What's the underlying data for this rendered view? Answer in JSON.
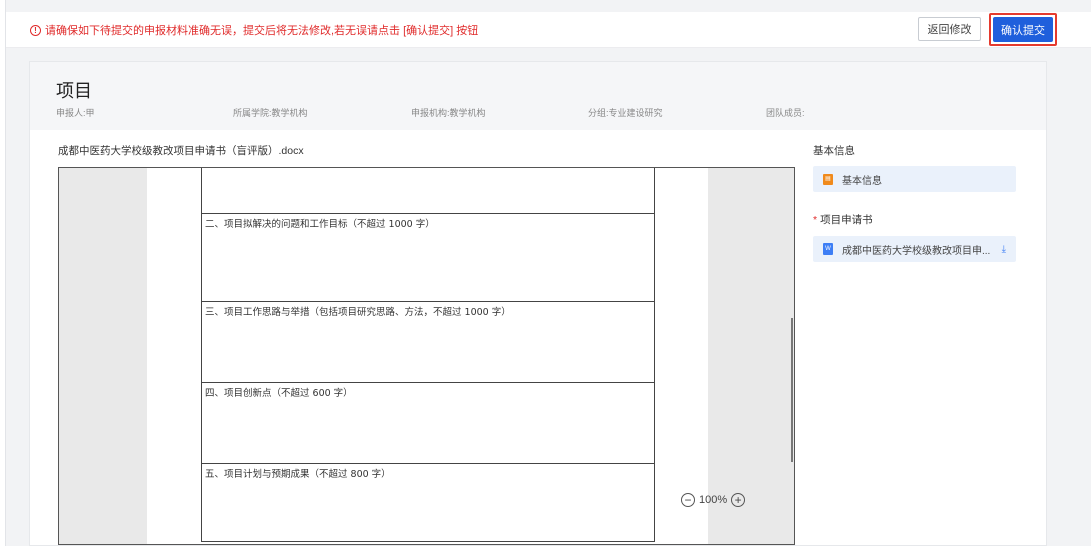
{
  "topbar": {
    "warning_icon": "info-circle-icon",
    "warning": "请确保如下待提交的申报材料准确无误，提交后将无法修改,若无误请点击 [确认提交] 按钮",
    "back_label": "返回修改",
    "confirm_label": "确认提交"
  },
  "project": {
    "title": "项目",
    "applicant": "申报人:甲",
    "college": "所属学院:教学机构",
    "institution": "申报机构:教学机构",
    "group": "分组:专业建设研究",
    "team": "团队成员:"
  },
  "document": {
    "name": "成都中医药大学校级教改项目申请书（盲评版）.docx",
    "sections": [
      "二、项目拟解决的问题和工作目标（不超过 1000 字）",
      "三、项目工作思路与举措（包括项目研究思路、方法，不超过 1000 字）",
      "四、项目创新点（不超过 600 字）",
      "五、项目计划与预期成果（不超过 800 字）"
    ],
    "zoom": "100%"
  },
  "sidebar": {
    "basic_heading": "基本信息",
    "basic_item": "基本信息",
    "required_mark": "*",
    "app_heading": "项目申请书",
    "file_item": "成都中医药大学校级教改项目申...",
    "file_icon": "word-file-icon",
    "download_icon": "download-icon"
  }
}
